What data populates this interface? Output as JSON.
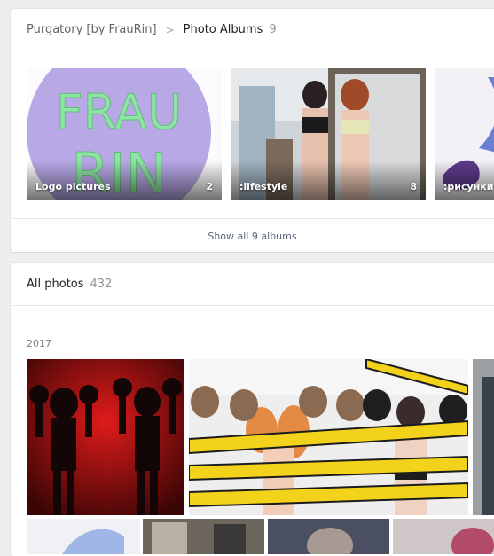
{
  "breadcrumb": {
    "parent": "Purgatory [by FrauRin]",
    "separator": ">",
    "current": "Photo Albums",
    "count": "9"
  },
  "albums": [
    {
      "title": "Logo pictures",
      "count": "2"
    },
    {
      "title": ":lifestyle",
      "count": "8"
    },
    {
      "title": ":рисунки",
      "count": ""
    }
  ],
  "logo_text": {
    "line1": "FRAU",
    "line2": "RIN"
  },
  "show_all": "Show all 9 albums",
  "all_photos": {
    "title": "All photos",
    "count": "432"
  },
  "year": "2017",
  "colors": {
    "accent_link": "#55677d",
    "logo_bg": "#b8a8e6",
    "logo_text": "#8fe3a4"
  }
}
